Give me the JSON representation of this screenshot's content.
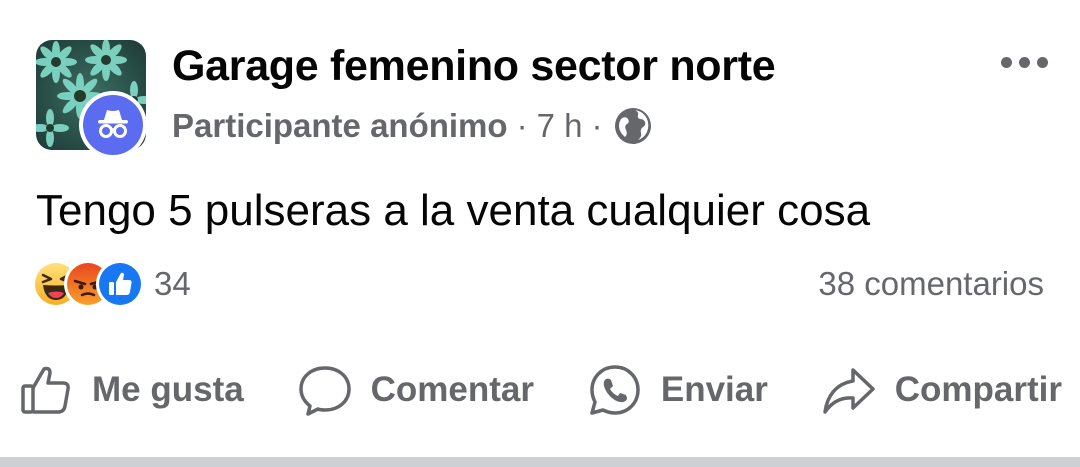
{
  "post": {
    "group_name": "Garage femenino sector norte",
    "author": "Participante anónimo",
    "separator": "·",
    "time": "7 h",
    "privacy_icon": "globe-icon",
    "more_icon": "more-horizontal-icon",
    "text": "Tengo 5 pulseras a la venta cualquier cosa"
  },
  "reactions": {
    "types": [
      "haha",
      "angry",
      "like"
    ],
    "count": "34"
  },
  "comments": {
    "label": "38 comentarios"
  },
  "actions": [
    {
      "label": "Me gusta",
      "icon": "like-outline-icon"
    },
    {
      "label": "Comentar",
      "icon": "comment-icon"
    },
    {
      "label": "Enviar",
      "icon": "whatsapp-icon"
    },
    {
      "label": "Compartir",
      "icon": "share-icon"
    }
  ],
  "colors": {
    "secondary_text": "#65676b",
    "anonymous_badge": "#5b6cf0",
    "like_blue": "#1877f2",
    "divider": "#cdd0d4"
  }
}
